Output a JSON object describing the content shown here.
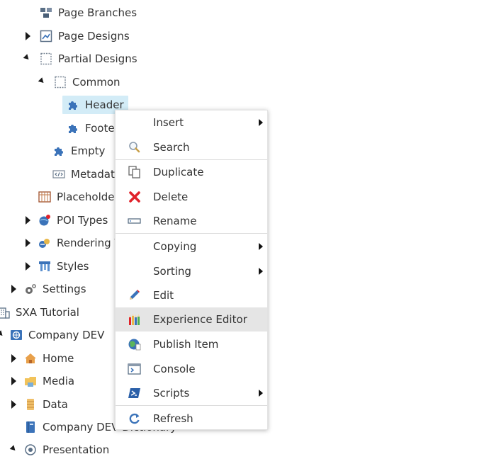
{
  "tree": {
    "page_branches": "Page Branches",
    "page_designs": "Page Designs",
    "partial_designs": "Partial Designs",
    "common": "Common",
    "header": "Header",
    "footer": "Footer",
    "empty": "Empty",
    "metadata": "Metadata",
    "placeholder": "Placeholder",
    "poi_types": "POI Types",
    "rendering": "Rendering V",
    "styles": "Styles",
    "settings": "Settings",
    "sxa_tutorial": "SXA Tutorial",
    "company_dev": "Company DEV",
    "home": "Home",
    "media": "Media",
    "data": "Data",
    "company_dev_dictionary": "Company DEV Dictionary",
    "presentation": "Presentation"
  },
  "context_menu": {
    "insert": "Insert",
    "search": "Search",
    "duplicate": "Duplicate",
    "delete": "Delete",
    "rename": "Rename",
    "copying": "Copying",
    "sorting": "Sorting",
    "edit": "Edit",
    "experience_editor": "Experience Editor",
    "publish_item": "Publish Item",
    "console": "Console",
    "scripts": "Scripts",
    "refresh": "Refresh"
  },
  "colors": {
    "selection": "#d3ecf7",
    "hover": "#e5e5e5",
    "icon_blue": "#3b73b9",
    "delete_red": "#e0222a"
  }
}
